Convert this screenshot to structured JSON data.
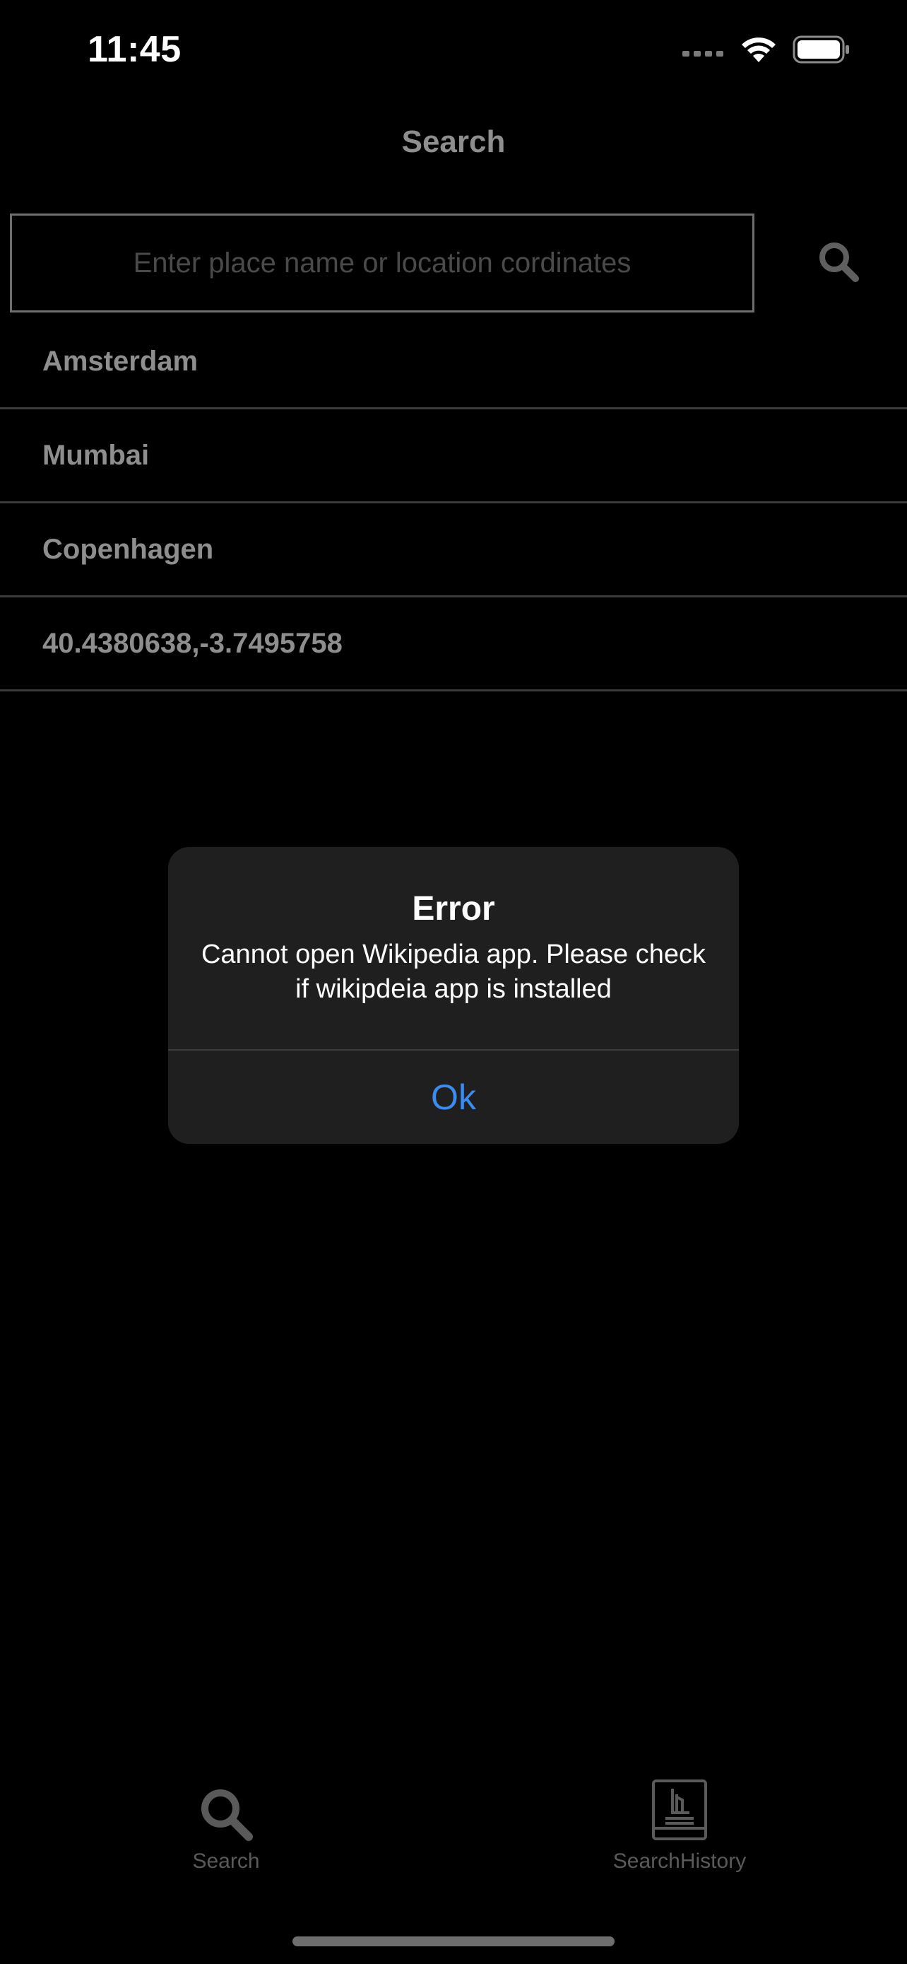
{
  "status_bar": {
    "time": "11:45",
    "icons": [
      "cellular-signal-icon",
      "wifi-icon",
      "battery-icon"
    ]
  },
  "nav": {
    "title": "Search"
  },
  "search": {
    "placeholder": "Enter place name or location cordinates",
    "value": "",
    "button_icon": "search-icon"
  },
  "history": {
    "items": [
      {
        "label": "Amsterdam"
      },
      {
        "label": "Mumbai"
      },
      {
        "label": "Copenhagen"
      },
      {
        "label": "40.4380638,-3.7495758"
      }
    ]
  },
  "alert": {
    "title": "Error",
    "message": "Cannot open Wikipedia app. Please check if wikipdeia app is installed",
    "ok_label": "Ok"
  },
  "tab_bar": {
    "tabs": [
      {
        "label": "Search",
        "icon": "search-icon"
      },
      {
        "label": "SearchHistory",
        "icon": "book-icon"
      }
    ]
  },
  "colors": {
    "background": "#000000",
    "alert_background": "#1f1f1f",
    "accent": "#3a8cf0",
    "muted_text": "#8e8e8e"
  }
}
